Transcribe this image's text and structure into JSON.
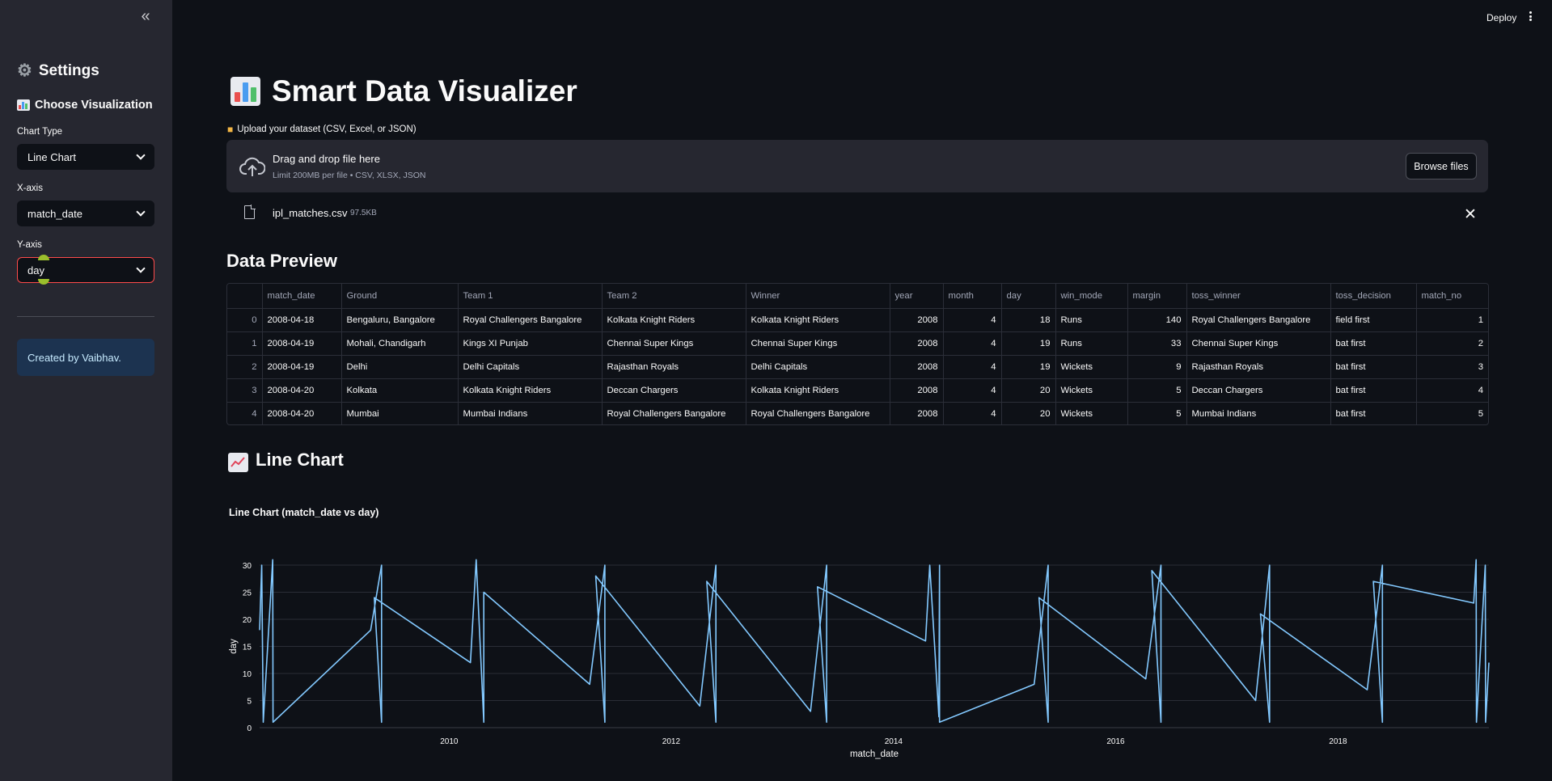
{
  "sidebar": {
    "collapse_icon": "«",
    "title": "Settings",
    "subtitle": "Choose Visualization",
    "chart_type_label": "Chart Type",
    "chart_type_value": "Line Chart",
    "x_axis_label": "X-axis",
    "x_axis_value": "match_date",
    "y_axis_label": "Y-axis",
    "y_axis_value": "day",
    "credit": "Created by Vaibhav."
  },
  "header": {
    "deploy_label": "Deploy"
  },
  "main": {
    "title": "Smart Data Visualizer",
    "upload_label": "Upload your dataset (CSV, Excel, or JSON)",
    "dropzone_title": "Drag and drop file here",
    "dropzone_limit": "Limit 200MB per file • CSV, XLSX, JSON",
    "browse_label": "Browse files",
    "file_name": "ipl_matches.csv",
    "file_size": "97.5KB",
    "preview_heading": "Data Preview",
    "chart_heading": "Line Chart",
    "chart_title": "Line Chart (match_date vs day)"
  },
  "table": {
    "columns": [
      "",
      "match_date",
      "Ground",
      "Team 1",
      "Team 2",
      "Winner",
      "year",
      "month",
      "day",
      "win_mode",
      "margin",
      "toss_winner",
      "toss_decision",
      "match_no"
    ],
    "rows": [
      [
        "0",
        "2008-04-18",
        "Bengaluru, Bangalore",
        "Royal Challengers Bangalore",
        "Kolkata Knight Riders",
        "Kolkata Knight Riders",
        "2008",
        "4",
        "18",
        "Runs",
        "140",
        "Royal Challengers Bangalore",
        "field first",
        "1"
      ],
      [
        "1",
        "2008-04-19",
        "Mohali, Chandigarh",
        "Kings XI Punjab",
        "Chennai Super Kings",
        "Chennai Super Kings",
        "2008",
        "4",
        "19",
        "Runs",
        "33",
        "Chennai Super Kings",
        "bat first",
        "2"
      ],
      [
        "2",
        "2008-04-19",
        "Delhi",
        "Delhi Capitals",
        "Rajasthan Royals",
        "Delhi Capitals",
        "2008",
        "4",
        "19",
        "Wickets",
        "9",
        "Rajasthan Royals",
        "bat first",
        "3"
      ],
      [
        "3",
        "2008-04-20",
        "Kolkata",
        "Kolkata Knight Riders",
        "Deccan Chargers",
        "Kolkata Knight Riders",
        "2008",
        "4",
        "20",
        "Wickets",
        "5",
        "Deccan Chargers",
        "bat first",
        "4"
      ],
      [
        "4",
        "2008-04-20",
        "Mumbai",
        "Mumbai Indians",
        "Royal Challengers Bangalore",
        "Royal Challengers Bangalore",
        "2008",
        "4",
        "20",
        "Wickets",
        "5",
        "Mumbai Indians",
        "bat first",
        "5"
      ]
    ]
  },
  "chart_data": {
    "type": "line",
    "title": "Line Chart (match_date vs day)",
    "xlabel": "match_date",
    "ylabel": "day",
    "ylim": [
      0,
      30
    ],
    "yticks": [
      0,
      5,
      10,
      15,
      20,
      25,
      30
    ],
    "xticks": [
      "2010",
      "2012",
      "2014",
      "2016",
      "2018"
    ],
    "xlim": [
      "2008-04-18",
      "2019-05-12"
    ],
    "grid": true,
    "color": "#83c9ff",
    "series": [
      {
        "x": [
          "2008-04-18",
          "2008-04-25",
          "2008-04-30",
          "2008-05-31",
          "2008-06-01",
          "2008-06-01",
          "2009-04-18",
          "2009-05-24",
          "2009-05-24",
          "2009-04-30",
          "2010-03-12",
          "2010-03-31",
          "2010-04-25",
          "2010-04-25",
          "2011-04-08",
          "2011-05-28",
          "2011-05-28",
          "2011-04-28",
          "2012-04-04",
          "2012-05-27",
          "2012-05-27",
          "2012-04-27",
          "2013-04-03",
          "2013-05-26",
          "2013-05-26",
          "2013-04-26",
          "2014-04-16",
          "2014-04-30",
          "2014-05-30",
          "2014-06-01",
          "2014-06-01",
          "2014-06-01",
          "2015-04-08",
          "2015-05-24",
          "2015-05-24",
          "2015-04-24",
          "2016-04-09",
          "2016-05-29",
          "2016-05-29",
          "2016-04-29",
          "2017-04-05",
          "2017-05-21",
          "2017-05-21",
          "2017-04-21",
          "2018-04-07",
          "2018-05-27",
          "2018-05-27",
          "2018-04-27",
          "2019-03-23",
          "2019-03-31",
          "2019-04-01",
          "2019-04-30",
          "2019-05-01",
          "2019-05-12",
          "2019-05-12"
        ],
        "y": [
          18,
          30,
          1,
          31,
          1,
          1,
          18,
          30,
          1,
          24,
          12,
          31,
          1,
          25,
          8,
          30,
          1,
          28,
          4,
          30,
          1,
          27,
          3,
          30,
          1,
          26,
          16,
          30,
          2,
          30,
          1,
          1,
          8,
          30,
          1,
          24,
          9,
          30,
          1,
          29,
          5,
          30,
          1,
          21,
          7,
          30,
          1,
          27,
          23,
          31,
          1,
          30,
          1,
          12,
          12
        ]
      }
    ]
  }
}
